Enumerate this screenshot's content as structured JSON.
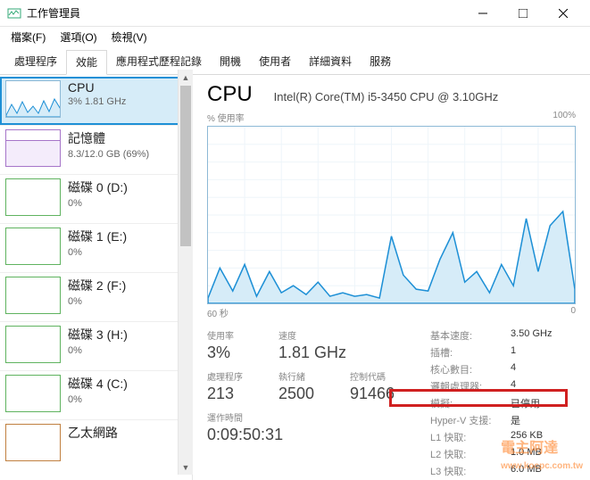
{
  "window": {
    "title": "工作管理員"
  },
  "menu": {
    "file": "檔案(F)",
    "options": "選項(O)",
    "view": "檢視(V)"
  },
  "tabs": {
    "processes": "處理程序",
    "performance": "效能",
    "apphistory": "應用程式歷程記錄",
    "startup": "開機",
    "users": "使用者",
    "details": "詳細資料",
    "services": "服務"
  },
  "sidebar": {
    "items": [
      {
        "name": "CPU",
        "sub": "3% 1.81 GHz"
      },
      {
        "name": "記憶體",
        "sub": "8.3/12.0 GB (69%)"
      },
      {
        "name": "磁碟 0 (D:)",
        "sub": "0%"
      },
      {
        "name": "磁碟 1 (E:)",
        "sub": "0%"
      },
      {
        "name": "磁碟 2 (F:)",
        "sub": "0%"
      },
      {
        "name": "磁碟 3 (H:)",
        "sub": "0%"
      },
      {
        "name": "磁碟 4 (C:)",
        "sub": "0%"
      },
      {
        "name": "乙太網路",
        "sub": ""
      }
    ]
  },
  "main": {
    "title": "CPU",
    "model": "Intel(R) Core(TM) i5-3450 CPU @ 3.10GHz",
    "ylabel": "% 使用率",
    "ymax": "100%",
    "xleft": "60 秒",
    "xright": "0",
    "usage": {
      "label": "使用率",
      "value": "3%"
    },
    "speed": {
      "label": "速度",
      "value": "1.81 GHz"
    },
    "processes": {
      "label": "處理程序",
      "value": "213"
    },
    "threads": {
      "label": "執行緒",
      "value": "2500"
    },
    "handles": {
      "label": "控制代碼",
      "value": "91466"
    },
    "uptime": {
      "label": "運作時間",
      "value": "0:09:50:31"
    },
    "details": [
      {
        "k": "基本速度:",
        "v": "3.50 GHz"
      },
      {
        "k": "插槽:",
        "v": "1"
      },
      {
        "k": "核心數目:",
        "v": "4"
      },
      {
        "k": "邏輯處理器:",
        "v": "4"
      },
      {
        "k": "模擬:",
        "v": "已停用"
      },
      {
        "k": "Hyper-V 支援:",
        "v": "是"
      },
      {
        "k": "L1 快取:",
        "v": "256 KB"
      },
      {
        "k": "L2 快取:",
        "v": "1.0 MB"
      },
      {
        "k": "L3 快取:",
        "v": "6.0 MB"
      }
    ]
  },
  "watermark": "電主阿達",
  "watermark_url": "www.kocpc.com.tw",
  "chart_data": {
    "type": "line",
    "title": "% 使用率",
    "xlabel": "60 秒 → 0",
    "ylabel": "% 使用率",
    "ylim": [
      0,
      100
    ],
    "x": [
      60,
      58,
      56,
      54,
      52,
      50,
      48,
      46,
      44,
      42,
      40,
      38,
      36,
      34,
      32,
      30,
      28,
      26,
      24,
      22,
      20,
      18,
      16,
      14,
      12,
      10,
      8,
      6,
      4,
      2,
      0
    ],
    "values": [
      3,
      20,
      7,
      22,
      4,
      18,
      6,
      10,
      5,
      12,
      4,
      6,
      4,
      5,
      3,
      38,
      16,
      8,
      7,
      25,
      40,
      12,
      18,
      6,
      22,
      10,
      48,
      18,
      44,
      52,
      8
    ]
  }
}
